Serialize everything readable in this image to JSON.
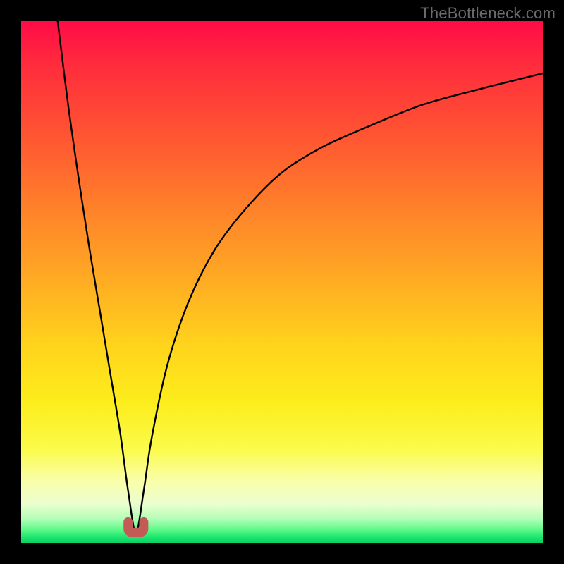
{
  "watermark": "TheBottleneck.com",
  "colors": {
    "page_bg": "#000000",
    "marker": "#c45a55",
    "curve": "#000000",
    "gradient_stops": [
      "#ff0b47",
      "#ff2b3d",
      "#ff5532",
      "#ff7e2a",
      "#ffa624",
      "#ffd31c",
      "#fced1c",
      "#fbfb4a",
      "#f9fea8",
      "#ecfed0",
      "#b0feb7",
      "#5cf986",
      "#17e56e",
      "#0fcf62"
    ]
  },
  "chart_data": {
    "type": "line",
    "title": "",
    "xlabel": "",
    "ylabel": "",
    "xlim": [
      0,
      100
    ],
    "ylim": [
      0,
      100
    ],
    "grid": false,
    "legend": false,
    "note": "V-shaped curve with minimum near x≈22, y≈2, rising steeply to the left (to y≈100 at x≈7) and asymptotically toward y≈90 on the right. Axis values are estimated from pixel positions; the original chart has no tick labels.",
    "series": [
      {
        "name": "curve",
        "x": [
          7,
          9,
          11,
          13,
          15,
          17,
          19,
          20.5,
          22,
          23.5,
          25,
          28,
          32,
          37,
          43,
          50,
          58,
          67,
          77,
          88,
          100
        ],
        "y": [
          100,
          84,
          70,
          57,
          45,
          33,
          21,
          10,
          2,
          10,
          20,
          34,
          46,
          56,
          64,
          71,
          76,
          80,
          84,
          87,
          90
        ]
      }
    ],
    "marker": {
      "name": "minimum",
      "shape": "u",
      "x_range": [
        20.5,
        23.5
      ],
      "y": 2
    }
  }
}
